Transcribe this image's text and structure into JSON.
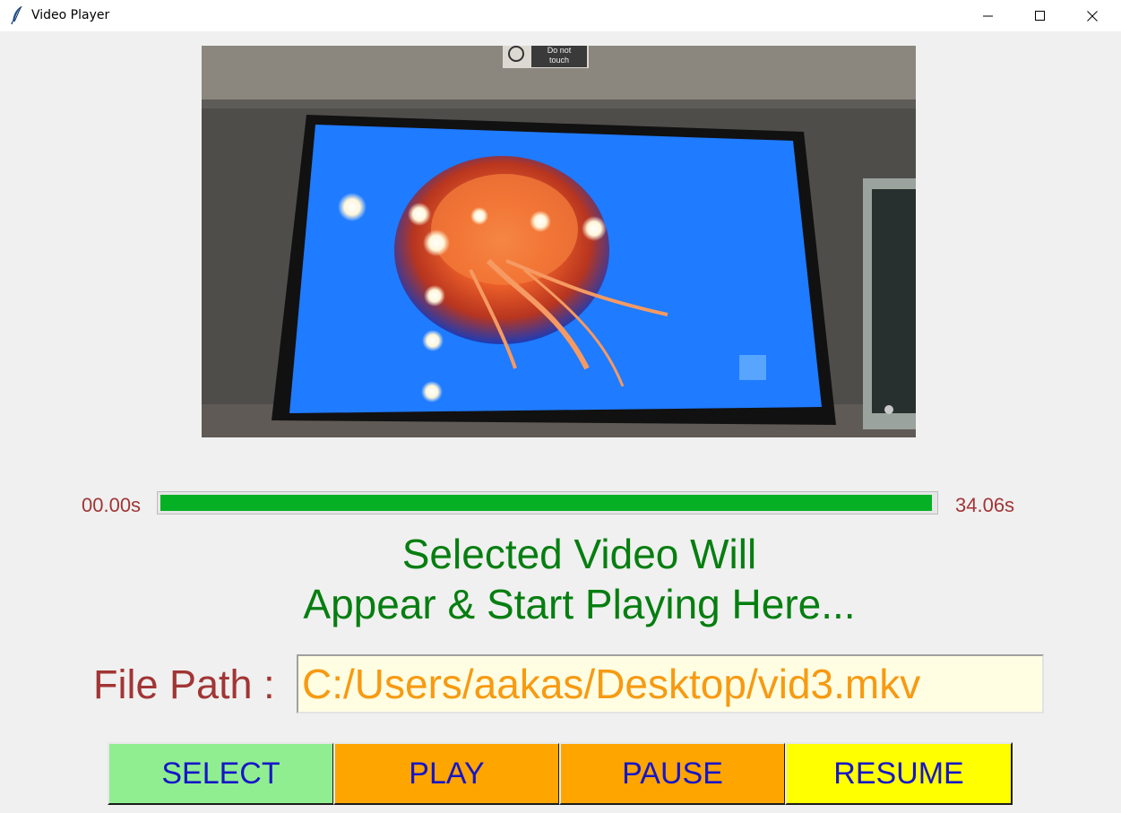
{
  "window": {
    "title": "Video Player",
    "icon": "feather-icon",
    "controls": [
      "minimize-icon",
      "maximize-icon",
      "close-icon"
    ]
  },
  "video": {
    "sign_text_line1": "Do not",
    "sign_text_line2": "touch"
  },
  "progress": {
    "start_time": "00.00s",
    "end_time": "34.06s",
    "fraction": 0.997,
    "color": "#06b025"
  },
  "message": {
    "line1": "Selected Video Will",
    "line2": "Appear & Start Playing Here..."
  },
  "file_path": {
    "label": "File Path :",
    "value": "C:/Users/aakas/Desktop/vid3.mkv"
  },
  "buttons": {
    "select": "SELECT",
    "play": "PLAY",
    "pause": "PAUSE",
    "resume": "RESUME"
  },
  "colors": {
    "select_bg": "#90ee90",
    "play_bg": "#ffa500",
    "pause_bg": "#ffa500",
    "resume_bg": "#ffff00",
    "button_text": "#1616c8",
    "message_text": "#067e10",
    "label_text": "#a23535",
    "path_text": "#f79a12"
  }
}
